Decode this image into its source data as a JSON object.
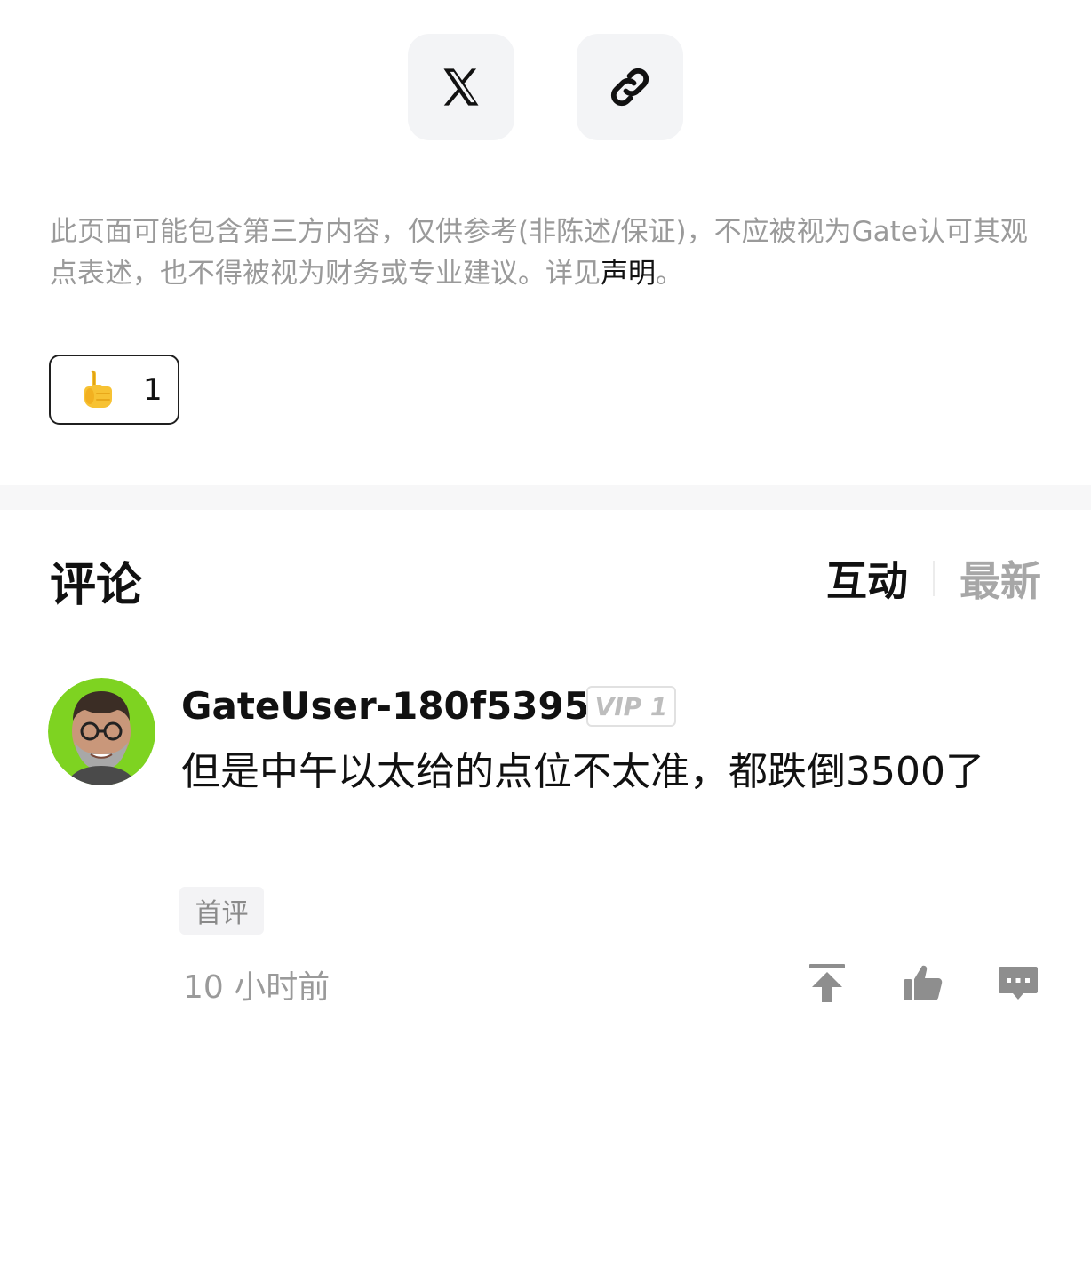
{
  "share": {
    "x_icon": "x-logo-icon",
    "link_icon": "link-icon"
  },
  "disclaimer": {
    "text": "此页面可能包含第三方内容，仅供参考(非陈述/保证)，不应被视为Gate认可其观点表述，也不得被视为财务或专业建议。详见",
    "link_label": "声明",
    "suffix": "。"
  },
  "reaction": {
    "emoji": "👍",
    "count": "1"
  },
  "comments": {
    "title": "评论",
    "sort_tabs": [
      {
        "label": "互动",
        "active": true
      },
      {
        "label": "最新",
        "active": false
      }
    ],
    "items": [
      {
        "username": "GateUser-180f5395",
        "vip": "VIP 1",
        "text": "但是中午以太给的点位不太准，都跌倒3500了",
        "tag": "首评",
        "time": "10 小时前"
      }
    ]
  },
  "colors": {
    "avatar_bg": "#7ed321",
    "muted_text": "#9a9a9a",
    "icon_gray": "#8e8e8e"
  }
}
